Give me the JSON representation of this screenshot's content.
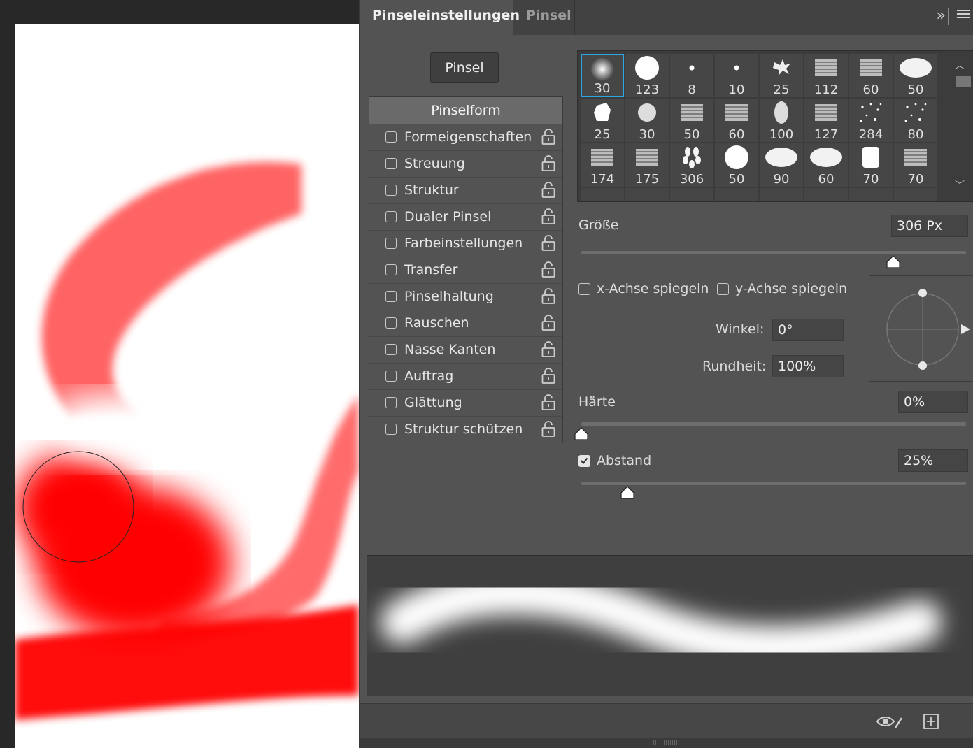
{
  "tabs": [
    {
      "label": "Pinseleinstellungen",
      "active": true
    },
    {
      "label": "Pinsel",
      "active": false
    }
  ],
  "tab_icons": {
    "collapse": "double-chevron-right-icon",
    "menu": "hamburger-menu-icon"
  },
  "brush_button": "Pinsel",
  "options": {
    "header": "Pinselform",
    "items": [
      {
        "label": "Formeigenschaften",
        "checked": false
      },
      {
        "label": "Streuung",
        "checked": false
      },
      {
        "label": "Struktur",
        "checked": false
      },
      {
        "label": "Dualer Pinsel",
        "checked": false
      },
      {
        "label": "Farbeinstellungen",
        "checked": false
      },
      {
        "label": "Transfer",
        "checked": false
      },
      {
        "label": "Pinselhaltung",
        "checked": false
      },
      {
        "label": "Rauschen",
        "checked": false
      },
      {
        "label": "Nasse Kanten",
        "checked": false
      },
      {
        "label": "Auftrag",
        "checked": false
      },
      {
        "label": "Glättung",
        "checked": false
      },
      {
        "label": "Struktur schützen",
        "checked": false
      }
    ]
  },
  "presets": [
    {
      "size": "30",
      "shape": "soft",
      "selected": true
    },
    {
      "size": "123",
      "shape": "hard"
    },
    {
      "size": "8",
      "shape": "dot"
    },
    {
      "size": "10",
      "shape": "dot"
    },
    {
      "size": "25",
      "shape": "splat"
    },
    {
      "size": "112",
      "shape": "texture"
    },
    {
      "size": "60",
      "shape": "texture"
    },
    {
      "size": "50",
      "shape": "ellipse"
    },
    {
      "size": "25",
      "shape": "blob"
    },
    {
      "size": "30",
      "shape": "fuzzy"
    },
    {
      "size": "50",
      "shape": "texture"
    },
    {
      "size": "60",
      "shape": "texture"
    },
    {
      "size": "100",
      "shape": "oval"
    },
    {
      "size": "127",
      "shape": "texture"
    },
    {
      "size": "284",
      "shape": "spray"
    },
    {
      "size": "80",
      "shape": "spray"
    },
    {
      "size": "174",
      "shape": "texture"
    },
    {
      "size": "175",
      "shape": "texture"
    },
    {
      "size": "306",
      "shape": "leaves"
    },
    {
      "size": "50",
      "shape": "hard"
    },
    {
      "size": "90",
      "shape": "ellipse"
    },
    {
      "size": "60",
      "shape": "ellipse"
    },
    {
      "size": "70",
      "shape": "square"
    },
    {
      "size": "70",
      "shape": "texture"
    }
  ],
  "size": {
    "label": "Größe",
    "value": "306 Px",
    "slider": 0.81
  },
  "flip_x": {
    "label": "x-Achse spiegeln",
    "checked": false
  },
  "flip_y": {
    "label": "y-Achse spiegeln",
    "checked": false
  },
  "angle": {
    "label": "Winkel:",
    "value": "0°"
  },
  "roundness": {
    "label": "Rundheit:",
    "value": "100%"
  },
  "hardness": {
    "label": "Härte",
    "value": "0%",
    "slider": 0.0
  },
  "spacing": {
    "label": "Abstand",
    "value": "25%",
    "checked": true,
    "slider": 0.12
  },
  "colors": {
    "brush": "#ff0000",
    "accent": "#2ea5e8",
    "panel": "#535353"
  }
}
